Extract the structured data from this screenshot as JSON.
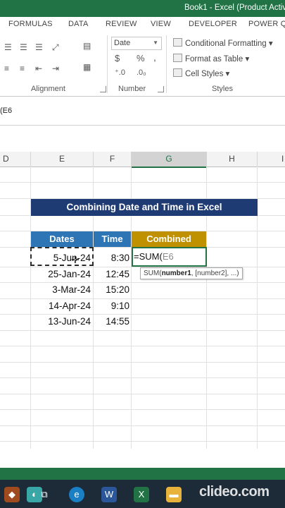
{
  "window": {
    "title": "Book1 - Excel (Product Activ"
  },
  "ribbon": {
    "tabs": [
      "FORMULAS",
      "DATA",
      "REVIEW",
      "VIEW",
      "DEVELOPER",
      "POWER QU"
    ],
    "groups": {
      "alignment": "Alignment",
      "number": "Number",
      "styles": "Styles"
    },
    "number": {
      "format": "Date",
      "currency": "$",
      "percent": "%",
      "comma": ","
    },
    "styles": {
      "conditional": "Conditional Formatting",
      "table": "Format as Table",
      "cell": "Cell Styles"
    }
  },
  "formula_bar": {
    "visible_text": "(E6"
  },
  "columns": [
    "D",
    "E",
    "F",
    "G",
    "H",
    "I"
  ],
  "sheet": {
    "banner": "Combining Date and Time in Excel",
    "headers": {
      "dates": "Dates",
      "time": "Time",
      "combined": "Combined"
    },
    "rows": [
      {
        "date": "5-Jun-24",
        "time": "8:30"
      },
      {
        "date": "25-Jan-24",
        "time": "12:45"
      },
      {
        "date": "3-Mar-24",
        "time": "15:20"
      },
      {
        "date": "14-Apr-24",
        "time": "9:10"
      },
      {
        "date": "13-Jun-24",
        "time": "14:55"
      }
    ],
    "editing": {
      "formula_prefix": "=SUM(",
      "formula_ref": "E6"
    },
    "tooltip": {
      "fn": "SUM(",
      "arg1": "number1",
      "rest": ", [number2], ...)"
    }
  },
  "colors": {
    "excel_green": "#217346",
    "banner_bg": "#1f3b73",
    "dates_header_bg": "#2e75b6",
    "time_header_bg": "#2e75b6",
    "combined_header_bg": "#bf9000"
  },
  "watermark": "clideo.com",
  "taskbar": {
    "icons": [
      "file-explorer-icon",
      "edge-icon",
      "word-icon",
      "excel-icon",
      "folder-icon",
      "app-icon"
    ]
  }
}
